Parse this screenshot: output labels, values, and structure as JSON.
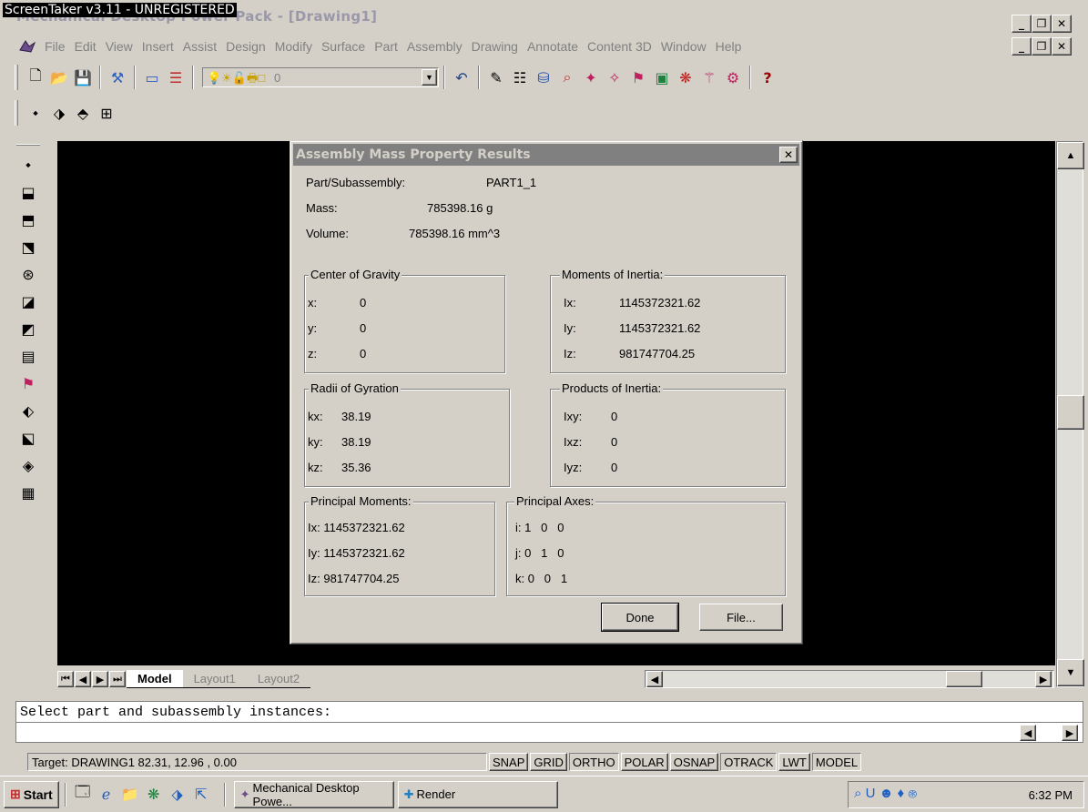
{
  "window": {
    "watermark": "ScreenTaker v3.11 - UNREGISTERED",
    "title": "Mechanical Desktop Power Pack - [Drawing1]"
  },
  "menu": [
    "File",
    "Edit",
    "View",
    "Insert",
    "Assist",
    "Design",
    "Modify",
    "Surface",
    "Part",
    "Assembly",
    "Drawing",
    "Annotate",
    "Content 3D",
    "Window",
    "Help"
  ],
  "toolbar": {
    "layer_value": "0"
  },
  "tabs": {
    "model": "Model",
    "layout1": "Layout1",
    "layout2": "Layout2"
  },
  "command": {
    "prompt": "Select part and subassembly instances:"
  },
  "status": {
    "coords": "Target: DRAWING1 82.31, 12.96 , 0.00",
    "buttons": [
      "SNAP",
      "GRID",
      "ORTHO",
      "POLAR",
      "OSNAP",
      "OTRACK",
      "LWT",
      "MODEL"
    ]
  },
  "taskbar": {
    "start": "Start",
    "tasks": [
      "Mechanical Desktop Powe...",
      "Render"
    ],
    "clock": "6:32 PM"
  },
  "dialog": {
    "title": "Assembly Mass Property Results",
    "part_label": "Part/Subassembly:",
    "part_value": "PART1_1",
    "mass_label": "Mass:",
    "mass_value": "785398.16 g",
    "volume_label": "Volume:",
    "volume_value": "785398.16 mm^3",
    "cog": {
      "title": "Center of Gravity",
      "x_label": "x:",
      "x": "0",
      "y_label": "y:",
      "y": "0",
      "z_label": "z:",
      "z": "0"
    },
    "moi": {
      "title": "Moments of Inertia:",
      "ix_label": "Ix:",
      "ix": "1145372321.62",
      "iy_label": "Iy:",
      "iy": "1145372321.62",
      "iz_label": "Iz:",
      "iz": "981747704.25"
    },
    "rog": {
      "title": "Radii of Gyration",
      "kx_label": "kx:",
      "kx": "38.19",
      "ky_label": "ky:",
      "ky": "38.19",
      "kz_label": "kz:",
      "kz": "35.36"
    },
    "poi": {
      "title": "Products of Inertia:",
      "ixy_label": "Ixy:",
      "ixy": "0",
      "ixz_label": "Ixz:",
      "ixz": "0",
      "iyz_label": "Iyz:",
      "iyz": "0"
    },
    "pm": {
      "title": "Principal Moments:",
      "ix": "Ix: 1145372321.62",
      "iy": "Iy: 1145372321.62",
      "iz": "Iz: 981747704.25"
    },
    "pa": {
      "title": "Principal Axes:",
      "i": "i: 1   0   0",
      "j": "j: 0   1   0",
      "k": "k: 0   0   1"
    },
    "done": "Done",
    "file": "File..."
  }
}
